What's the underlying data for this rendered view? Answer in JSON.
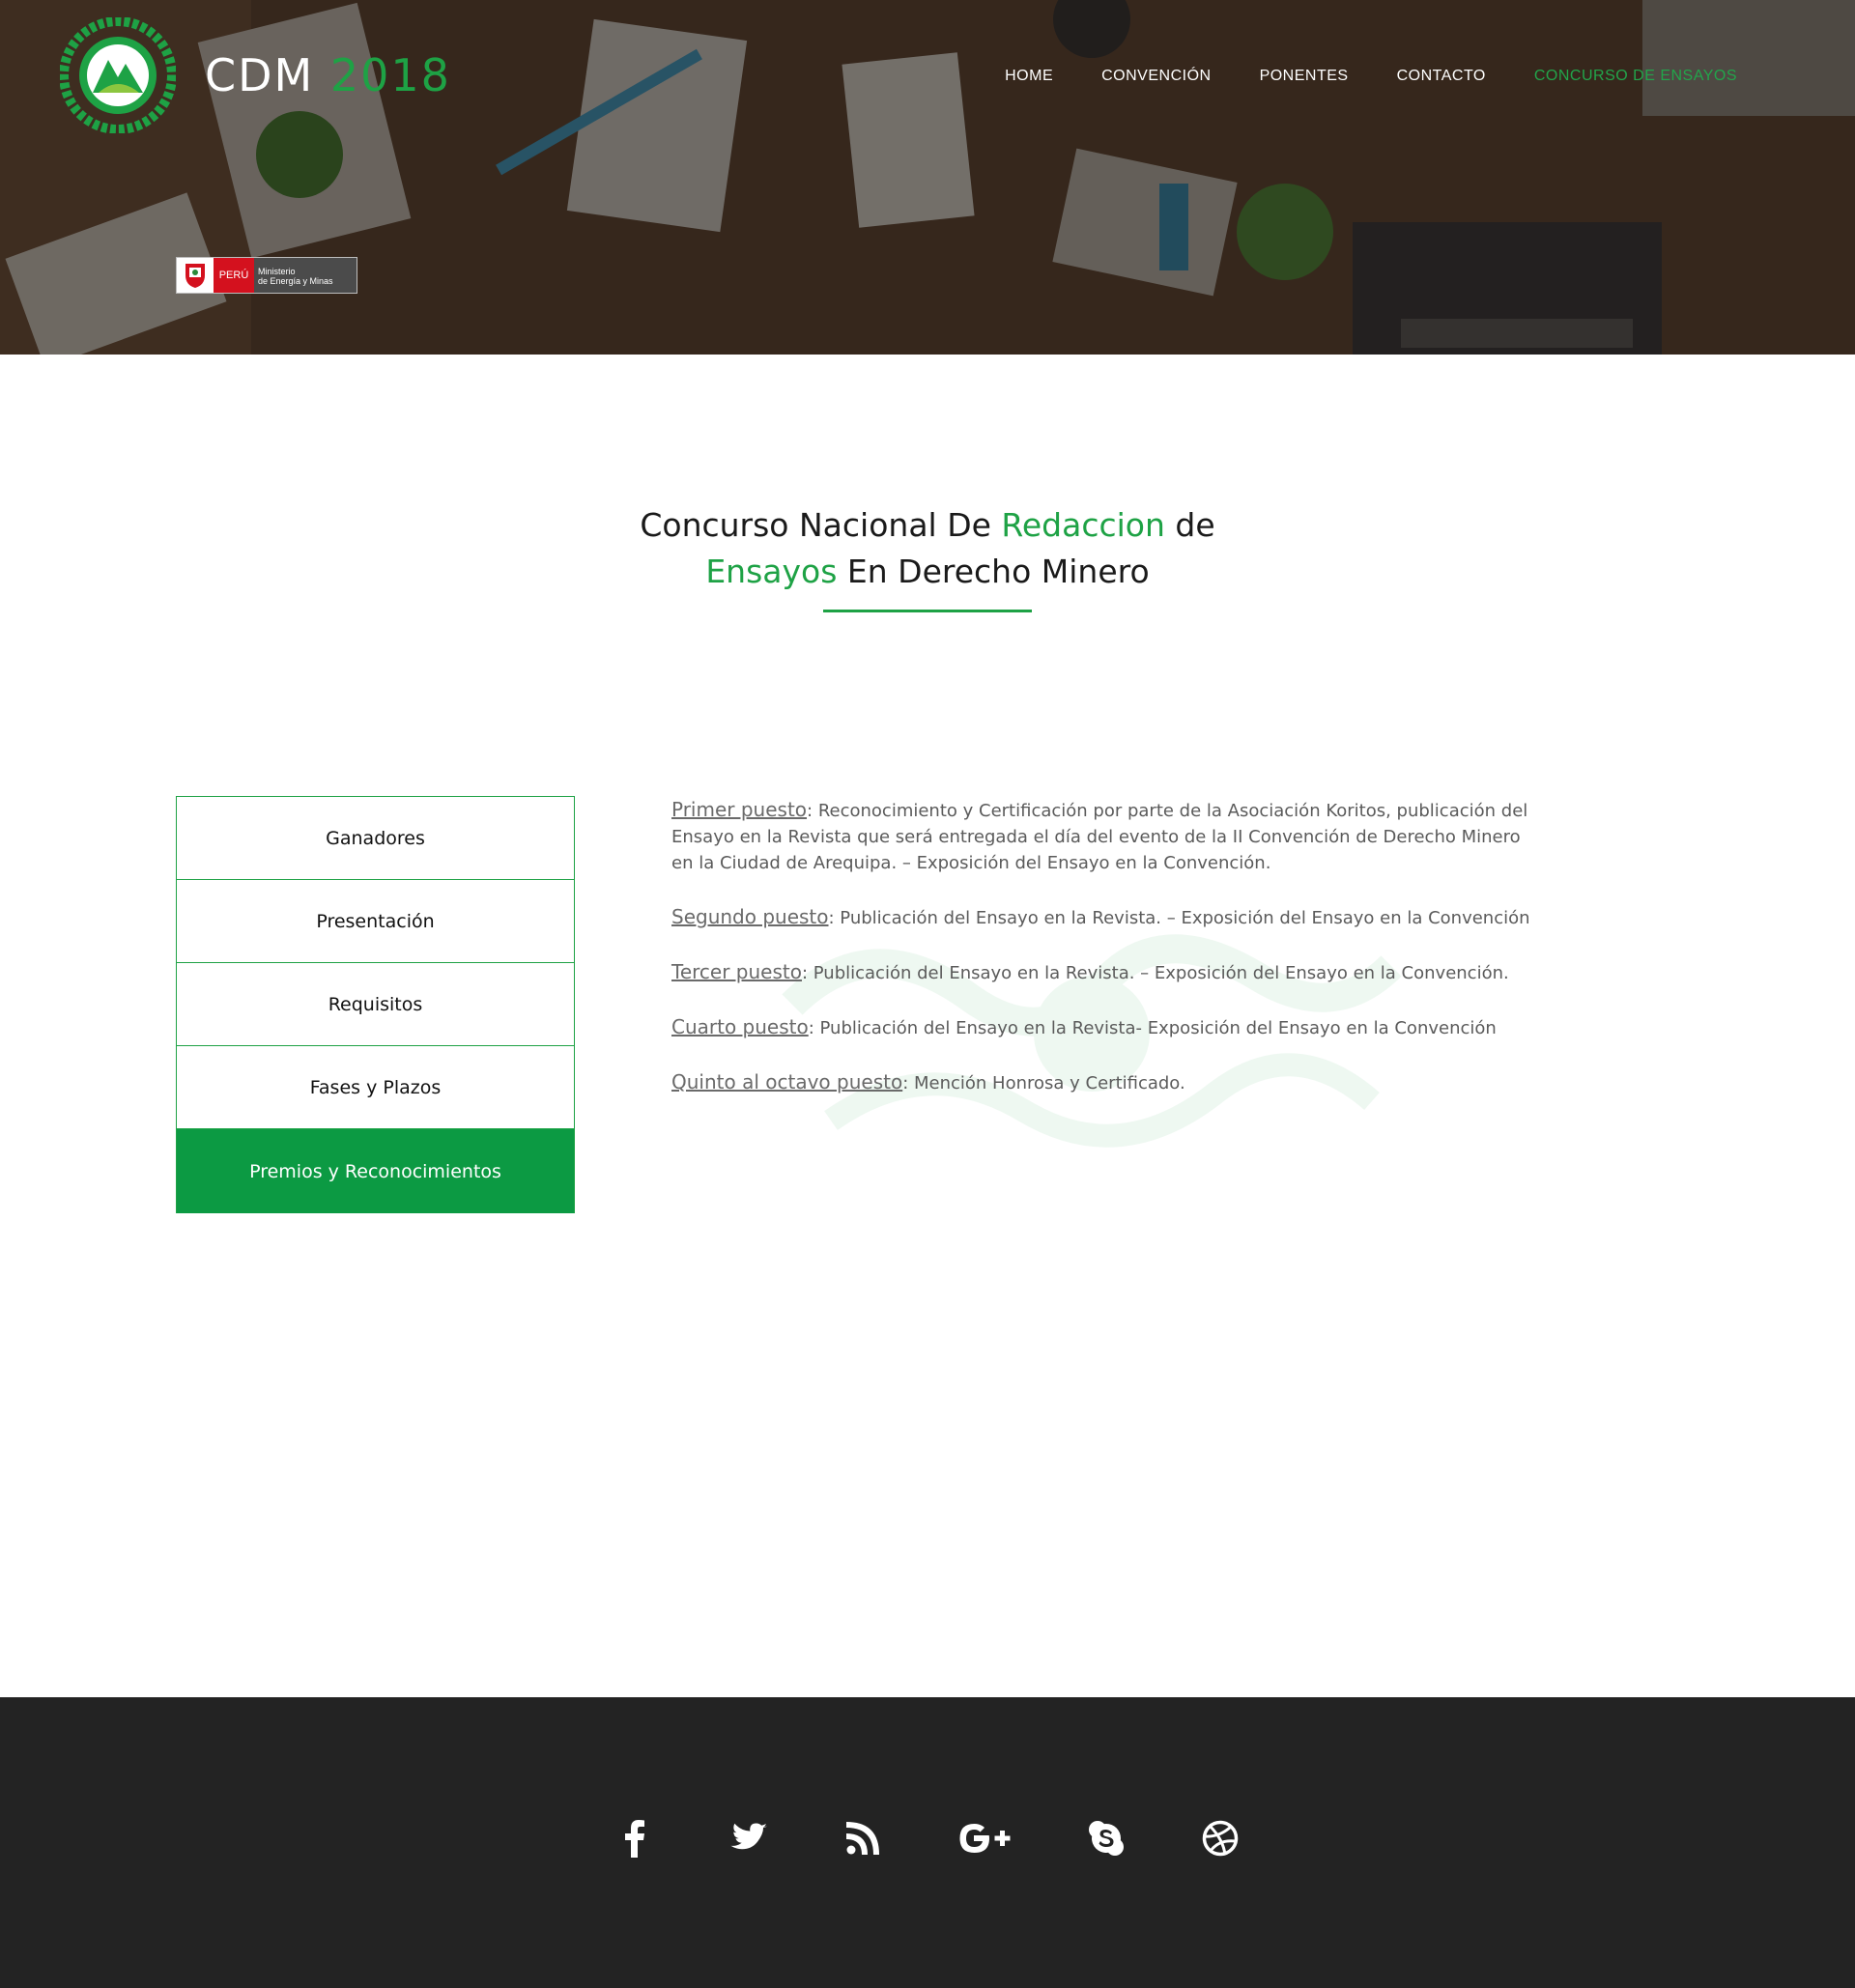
{
  "brand": {
    "name": "CDM",
    "year": "2018"
  },
  "nav": {
    "items": [
      {
        "label": "HOME"
      },
      {
        "label": "CONVENCIÓN"
      },
      {
        "label": "PONENTES"
      },
      {
        "label": "CONTACTO"
      },
      {
        "label": "CONCURSO DE ENSAYOS",
        "active": true
      }
    ]
  },
  "sponsor": {
    "country": "PERÚ",
    "ministry_line1": "Ministerio",
    "ministry_line2": "de Energía y Minas"
  },
  "heading": {
    "part1": "Concurso Nacional De ",
    "part2": "Redaccion",
    "part3": " de",
    "part4": "Ensayos",
    "part5": " En Derecho Minero"
  },
  "tabs": [
    {
      "label": "Ganadores"
    },
    {
      "label": "Presentación"
    },
    {
      "label": "Requisitos"
    },
    {
      "label": "Fases y Plazos"
    },
    {
      "label": "Premios y Reconocimientos",
      "active": true
    }
  ],
  "prizes": [
    {
      "label": "Primer puesto",
      "text": ": Reconocimiento y Certificación por parte de la Asociación Koritos, publicación del Ensayo en la Revista que será entregada el día del evento de la II Convención de Derecho Minero en la Ciudad de Arequipa. – Exposición del Ensayo en la Convención."
    },
    {
      "label": "Segundo puesto",
      "text": ": Publicación del Ensayo en la Revista. – Exposición del Ensayo en la Convención"
    },
    {
      "label": "Tercer puesto",
      "text": ": Publicación del Ensayo en la Revista.  – Exposición del Ensayo en la Convención."
    },
    {
      "label": "Cuarto puesto",
      "text": ": Publicación del Ensayo en la Revista- Exposición del Ensayo en la Convención"
    },
    {
      "label": "Quinto al octavo puesto",
      "text": ": Mención Honrosa y Certificado."
    }
  ],
  "footer": {
    "social": [
      "facebook-icon",
      "twitter-icon",
      "rss-icon",
      "google-plus-icon",
      "skype-icon",
      "dribbble-icon"
    ]
  },
  "colors": {
    "accent": "#1ea245",
    "active_tab": "#0c9a43",
    "footer_bg": "#232323"
  }
}
